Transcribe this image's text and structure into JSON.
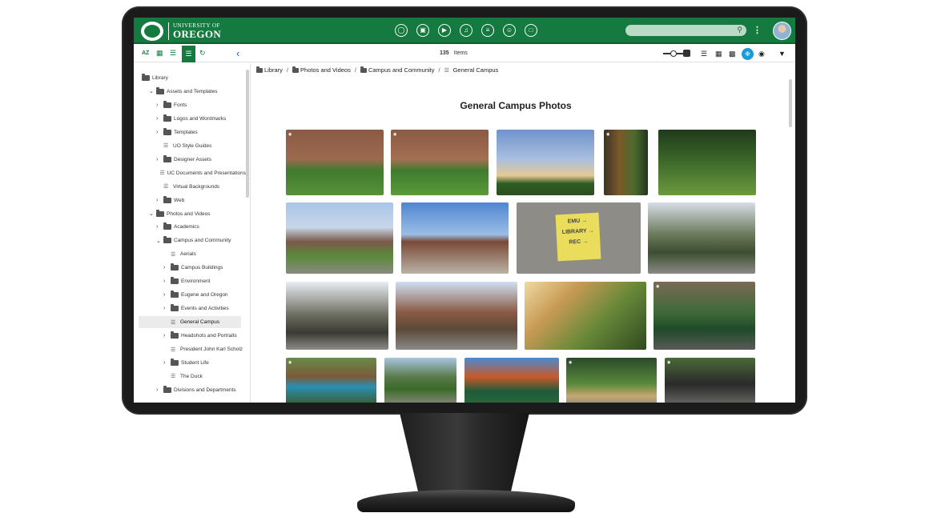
{
  "header": {
    "logo_line1": "UNIVERSITY OF",
    "logo_line2": "OREGON",
    "nav_icons": [
      "circle-icon",
      "image-icon",
      "play-icon",
      "music-icon",
      "document-icon",
      "chat-icon",
      "file-icon"
    ],
    "brand_color": "#157a3f"
  },
  "toolbar": {
    "sort_label": "AZ",
    "item_count": "135",
    "items_label": "Items",
    "active_view_color": "#1a9ad6"
  },
  "sidebar": {
    "items": [
      {
        "label": "Library",
        "level": 0,
        "kind": "folder",
        "caret": ""
      },
      {
        "label": "Assets and Templates",
        "level": 1,
        "kind": "folder",
        "caret": "v"
      },
      {
        "label": "Fonts",
        "level": 2,
        "kind": "folder",
        "caret": ">"
      },
      {
        "label": "Logos and Wordmarks",
        "level": 2,
        "kind": "folder",
        "caret": ">"
      },
      {
        "label": "Templates",
        "level": 2,
        "kind": "folder",
        "caret": ">"
      },
      {
        "label": "UO Style Guides",
        "level": 2,
        "kind": "stack",
        "caret": ""
      },
      {
        "label": "Designer Assets",
        "level": 2,
        "kind": "folder",
        "caret": ">"
      },
      {
        "label": "UC Documents and Presentations",
        "level": 2,
        "kind": "stack",
        "caret": ""
      },
      {
        "label": "Virtual Backgrounds",
        "level": 2,
        "kind": "stack",
        "caret": ""
      },
      {
        "label": "Web",
        "level": 2,
        "kind": "folder",
        "caret": ">"
      },
      {
        "label": "Photos and Videos",
        "level": 1,
        "kind": "folder",
        "caret": "v"
      },
      {
        "label": "Academics",
        "level": 2,
        "kind": "folder",
        "caret": ">"
      },
      {
        "label": "Campus and Community",
        "level": 2,
        "kind": "folder",
        "caret": "v"
      },
      {
        "label": "Aerials",
        "level": 3,
        "kind": "stack",
        "caret": ""
      },
      {
        "label": "Campus Buildings",
        "level": 3,
        "kind": "folder",
        "caret": ">"
      },
      {
        "label": "Environment",
        "level": 3,
        "kind": "folder",
        "caret": ">"
      },
      {
        "label": "Eugene and Oregon",
        "level": 3,
        "kind": "folder",
        "caret": ">"
      },
      {
        "label": "Events and Activities",
        "level": 3,
        "kind": "folder",
        "caret": ">"
      },
      {
        "label": "General Campus",
        "level": 3,
        "kind": "stack",
        "caret": "",
        "active": true
      },
      {
        "label": "Headshots and Portraits",
        "level": 3,
        "kind": "folder",
        "caret": ">"
      },
      {
        "label": "President John Karl Scholz",
        "level": 3,
        "kind": "stack",
        "caret": ""
      },
      {
        "label": "Student Life",
        "level": 3,
        "kind": "folder",
        "caret": ">"
      },
      {
        "label": "The Duck",
        "level": 3,
        "kind": "stack",
        "caret": ""
      },
      {
        "label": "Divisions and Departments",
        "level": 2,
        "kind": "folder",
        "caret": ">"
      }
    ]
  },
  "main": {
    "breadcrumb": [
      "Library",
      "Photos and Videos",
      "Campus and Community",
      "General Campus"
    ],
    "breadcrumb_sep": "/",
    "gallery_title": "General Campus Photos",
    "sign_lines": [
      "EMU →",
      "LIBRARY →",
      "REC →"
    ],
    "photos": [
      {
        "name": "photo-brick-dorm-path-1",
        "bg": "linear-gradient(180deg,#8a5a44 0%,#9c6a4f 45%,#3f7b2e 62%,#59913a 100%)"
      },
      {
        "name": "photo-brick-dorm-path-2",
        "bg": "linear-gradient(180deg,#8a5a44 0%,#a46f52 45%,#3f7b2e 62%,#5c9a3c 100%)"
      },
      {
        "name": "photo-sunset-sky-field",
        "bg": "linear-gradient(180deg,#6f93c9 0%,#a9bfe0 45%,#e6c994 70%,#2f5d22 82%,#2b4f1f 100%)"
      },
      {
        "name": "photo-autumn-tree",
        "bg": "linear-gradient(90deg,#3c3326 0%,#7a5a2a 35%,#4a6a2c 70%,#233520 100%)"
      },
      {
        "name": "photo-oak-tree-lawn",
        "bg": "linear-gradient(180deg,#1f3a1a 0%,#3e6a2a 50%,#6b9a3e 100%)"
      },
      {
        "name": "photo-campus-walkway",
        "bg": "linear-gradient(180deg,#a9c5e8 0%,#c8d6e8 35%,#7a5a4a 55%,#5a8a3a 75%,#8a8a80 100%)"
      },
      {
        "name": "photo-brick-building-plaza",
        "bg": "linear-gradient(180deg,#4f86cf 0%,#9bbde6 45%,#7a4a36 55%,#b9b2a6 100%)"
      },
      {
        "name": "photo-emu-library-sign",
        "bg": "#8e8c86"
      },
      {
        "name": "photo-tree-lined-street",
        "bg": "linear-gradient(180deg,#d7dde6 0%,#6a7a5a 45%,#3c4e30 70%,#8a8a86 100%)"
      },
      {
        "name": "photo-bare-trees-street",
        "bg": "linear-gradient(180deg,#e8edf3 0%,#6a6a5e 50%,#3a3a34 75%,#8e8c88 100%)"
      },
      {
        "name": "photo-brick-street-trees",
        "bg": "linear-gradient(180deg,#cfe0f2 0%,#8a5a44 45%,#5a4a3a 70%,#8c8a86 100%)"
      },
      {
        "name": "photo-sunlit-plants",
        "bg": "linear-gradient(135deg,#f0d9a0 0%,#c69a54 30%,#6a8a3a 60%,#2f4a1f 100%)"
      },
      {
        "name": "photo-duck-mascot",
        "bg": "linear-gradient(180deg,#7a6a56 0%,#3e6a3a 45%,#1f4a2a 70%,#5a5a56 100%)"
      },
      {
        "name": "photo-hammocks",
        "bg": "linear-gradient(180deg,#6a8a4a 0%,#7a5a3a 40%,#2a8fb0 60%,#3a5a2a 100%)"
      },
      {
        "name": "photo-student-walking",
        "bg": "linear-gradient(180deg,#a8c6e0 0%,#5a7a4a 40%,#3a6a2a 65%,#8a8a82 100%)"
      },
      {
        "name": "photo-campus-map-sign",
        "bg": "linear-gradient(180deg,#4a8ad0 0%,#c8592a 40%,#1f5a3a 70%,#2a6a3a 100%)"
      },
      {
        "name": "photo-green-lawn-path",
        "bg": "linear-gradient(180deg,#2a4a2a 0%,#5a8a3a 55%,#c8a870 80%,#8a8a82 100%)"
      },
      {
        "name": "photo-bicycles",
        "bg": "linear-gradient(180deg,#4a6a3a 0%,#2a2a2a 55%,#6a6a66 100%)"
      }
    ]
  }
}
